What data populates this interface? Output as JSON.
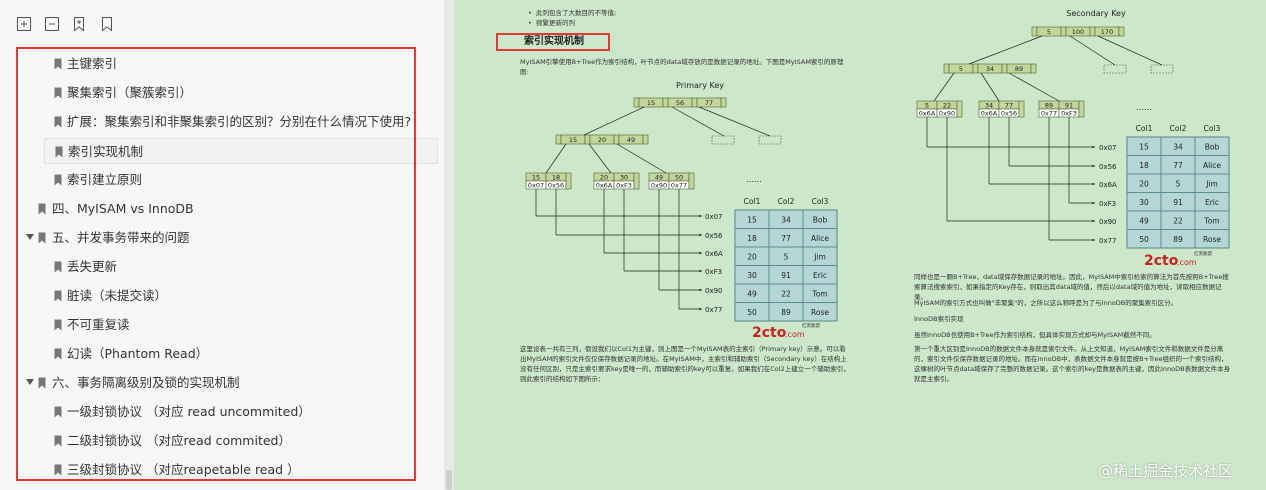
{
  "outline": {
    "items": [
      {
        "label": "主键索引",
        "level": 2,
        "expanded": false
      },
      {
        "label": "聚集索引（聚簇索引）",
        "level": 2,
        "expanded": false
      },
      {
        "label": "扩展：聚集索引和非聚集索引的区别？分别在什么情况下使用?",
        "level": 2,
        "expanded": false
      },
      {
        "label": "索引实现机制",
        "level": 2,
        "selected": true
      },
      {
        "label": "索引建立原则",
        "level": 2
      },
      {
        "label": "四、MyISAM vs InnoDB",
        "level": 1
      },
      {
        "label": "五、并发事务带来的问题",
        "level": 1,
        "expanded": true
      },
      {
        "label": "丢失更新",
        "level": 2
      },
      {
        "label": "脏读（未提交读）",
        "level": 2
      },
      {
        "label": "不可重复读",
        "level": 2
      },
      {
        "label": "幻读（Phantom Read）",
        "level": 2
      },
      {
        "label": "六、事务隔离级别及锁的实现机制",
        "level": 1,
        "expanded": true
      },
      {
        "label": "一级封锁协议 （对应 read uncommited）",
        "level": 2
      },
      {
        "label": "二级封锁协议 （对应read commited）",
        "level": 2
      },
      {
        "label": "三级封锁协议 （对应reapetable read ）",
        "level": 2
      }
    ]
  },
  "document": {
    "bullets": [
      "此列包含了大数目的不等值;",
      "频繁更新的列"
    ],
    "section_title": "索引实现机制",
    "intro": "MyISAM引擎使用B+Tree作为索引结构，叶节点的data域存放的是数据记录的地址。下图是MyISAM索引的原理图:",
    "primary_label": "Primary Key",
    "secondary_label": "Secondary Key",
    "left_para": "这里设表一共有三列，假设我们以Col1为主键，则上图是一个MyISAM表的主索引（Primary key）示意。可以看出MyISAM的索引文件仅仅保存数据记录的地址。在MyISAM中，主索引和辅助索引（Secondary key）在结构上没有任何区别，只是主索引要求key是唯一的，而辅助索引的key可以重复。如果我们在Col2上建立一个辅助索引，则此索引的结构如下图所示：",
    "right_para1": "同样也是一颗B+Tree，data域保存数据记录的地址。因此，MyISAM中索引检索的算法为首先按照B+Tree搜索算法搜索索引，如果指定的Key存在，则取出其data域的值，然后以data域的值为地址，读取相应数据记录。",
    "right_para2": "MyISAM的索引方式也叫做\"非聚集\"的，之所以这么称呼是为了与InnoDB的聚集索引区分。",
    "right_heading": "InnoDB索引实现",
    "right_para3": "虽然InnoDB也使用B+Tree作为索引结构，但具体实现方式却与MyISAM截然不同。",
    "right_para4": "第一个重大区别是InnoDB的数据文件本身就是索引文件。从上文知道，MyISAM索引文件和数据文件是分离的，索引文件仅保存数据记录的地址。而在InnoDB中，表数据文件本身就是按B+Tree组织的一个索引结构，这棵树的叶节点data域保存了完整的数据记录。这个索引的key是数据表的主键，因此InnoDB表数据文件本身就是主索引。",
    "table_headers": [
      "Col1",
      "Col2",
      "Col3"
    ],
    "left_table": [
      [
        "15",
        "34",
        "Bob"
      ],
      [
        "18",
        "77",
        "Alice"
      ],
      [
        "20",
        "5",
        "Jim"
      ],
      [
        "30",
        "91",
        "Eric"
      ],
      [
        "49",
        "22",
        "Tom"
      ],
      [
        "50",
        "89",
        "Rose"
      ]
    ],
    "right_table": [
      [
        "15",
        "34",
        "Bob"
      ],
      [
        "18",
        "77",
        "Alice"
      ],
      [
        "20",
        "5",
        "Jim"
      ],
      [
        "30",
        "91",
        "Eric"
      ],
      [
        "49",
        "22",
        "Tom"
      ],
      [
        "50",
        "89",
        "Rose"
      ]
    ],
    "addresses": [
      "0x07",
      "0x56",
      "0x6A",
      "0xF3",
      "0x90",
      "0x77"
    ],
    "pk_root": [
      "15",
      "56",
      "77"
    ],
    "pk_mid": [
      "15",
      "20",
      "49"
    ],
    "pk_leaves": [
      {
        "k": [
          "15",
          "18"
        ],
        "a": [
          "0x07",
          "0x56"
        ]
      },
      {
        "k": [
          "20",
          "30"
        ],
        "a": [
          "0x6A",
          "0xF3"
        ]
      },
      {
        "k": [
          "49",
          "50"
        ],
        "a": [
          "0x90",
          "0x77"
        ]
      }
    ],
    "sk_root": [
      "5",
      "100",
      "170"
    ],
    "sk_mid": [
      "5",
      "34",
      "89"
    ],
    "sk_leaves": [
      {
        "k": [
          "5",
          "22"
        ],
        "a": [
          "0x6A",
          "0x90"
        ]
      },
      {
        "k": [
          "34",
          "77"
        ],
        "a": [
          "0x6A",
          "0x56"
        ]
      },
      {
        "k": [
          "89",
          "91"
        ],
        "a": [
          "0x77",
          "0xF3"
        ]
      }
    ],
    "ellipsis": "......",
    "dots": ".....",
    "logo": "2cto",
    "logo_suffix": ".com",
    "logo_sub": "红黑联盟"
  },
  "watermark": "@稀土掘金技术社区"
}
